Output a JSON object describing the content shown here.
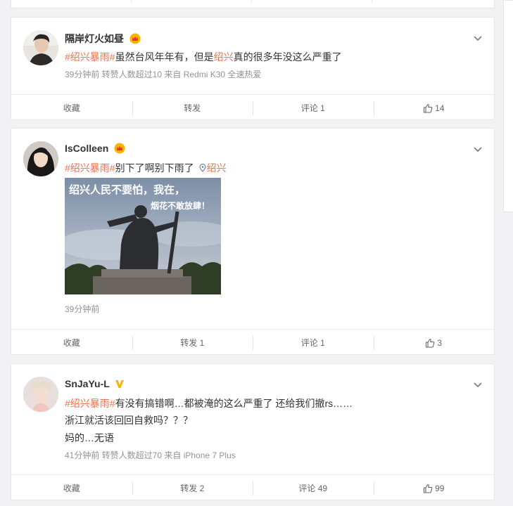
{
  "colors": {
    "topic": "#eb7350",
    "location": "#5d7ea6",
    "meta": "#939393"
  },
  "posts": [
    {
      "username": "隔岸灯火如昼",
      "badge_icon": "crown-badge-icon",
      "topic": "#绍兴暴雨#",
      "text_before": "虽然台风年年有，但是",
      "text_highlight": "绍兴",
      "text_after": "真的很多年没这么严重了",
      "meta": "39分钟前 转赞人数超过10 来自 Redmi K30 全速热爱",
      "actions": {
        "favorite": "收藏",
        "repost": "转发",
        "comment": "评论 1",
        "like": "14"
      }
    },
    {
      "username": "IsColleen",
      "badge_icon": "crown-badge-icon",
      "topic": "#绍兴暴雨#",
      "text": "别下了啊别下雨了",
      "location": "绍兴",
      "image_caption_line1": "绍兴人民不要怕，我在，",
      "image_caption_line2": "烟花不敢放肆！",
      "meta": "39分钟前",
      "actions": {
        "favorite": "收藏",
        "repost": "转发 1",
        "comment": "评论 1",
        "like": "3"
      }
    },
    {
      "username": "SnJaYu-L",
      "badge_icon": "verified-v-icon",
      "topic": "#绍兴暴雨#",
      "text": "有没有搞错啊…都被淹的这么严重了 还给我们撤rs……",
      "line2": "浙江就活该回回自救吗？？？",
      "line3": "妈的…无语",
      "meta": "41分钟前 转赞人数超过70 来自 iPhone 7 Plus",
      "actions": {
        "favorite": "收藏",
        "repost": "转发 2",
        "comment": "评论 49",
        "like": "99"
      }
    }
  ]
}
